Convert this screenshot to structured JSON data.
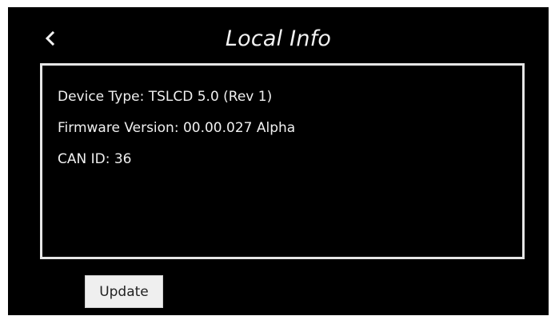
{
  "header": {
    "back_icon": "chevron-left-icon",
    "title": "Local Info"
  },
  "info": {
    "device_type": "Device Type: TSLCD 5.0 (Rev 1)",
    "firmware_version": "Firmware Version: 00.00.027 Alpha",
    "can_id": "CAN ID: 36"
  },
  "actions": {
    "update_label": "Update"
  },
  "colors": {
    "screen_background": "#000000",
    "text": "#f0f0f0",
    "panel_border": "#e6e6e6",
    "button_background": "#efefef"
  }
}
